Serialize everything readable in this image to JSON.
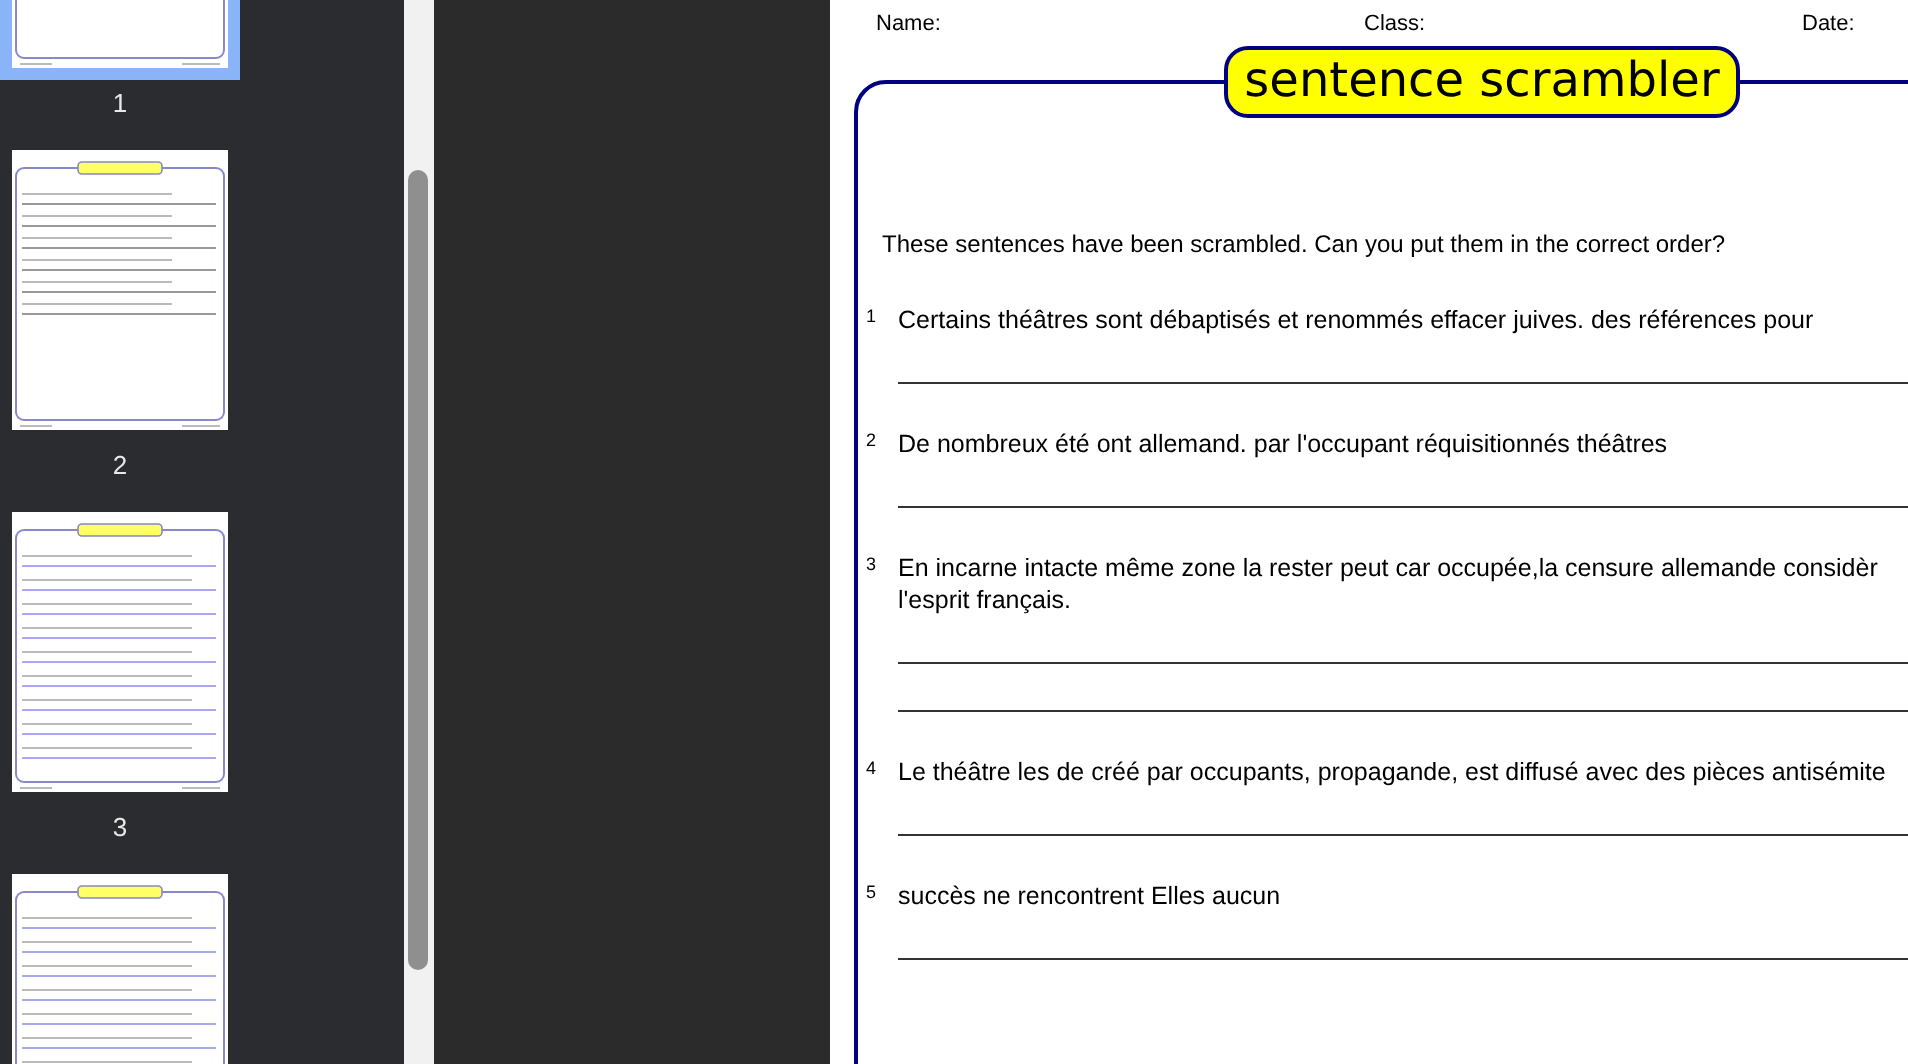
{
  "thumbnails": [
    {
      "label": "1",
      "selected": true,
      "kind": "questions"
    },
    {
      "label": "2",
      "selected": false,
      "kind": "questions"
    },
    {
      "label": "3",
      "selected": false,
      "kind": "answers"
    },
    {
      "selected": false,
      "kind": "answers"
    }
  ],
  "page": {
    "header": [
      "Name:",
      "Class:",
      "Date:"
    ],
    "title": "sentence scrambler",
    "instructions": "These sentences have been scrambled. Can you put them in the correct order?",
    "questions": [
      {
        "number": "1",
        "lines": [
          "Certains théâtres sont débaptisés et renommés effacer juives. des références pour"
        ],
        "kind": "single"
      },
      {
        "number": "2",
        "lines": [
          "De nombreux été ont allemand. par l'occupant réquisitionnés théâtres"
        ],
        "kind": "single"
      },
      {
        "number": "3",
        "lines": [
          "En incarne intacte même zone la rester peut car occupée,la censure allemande considèr",
          "l'esprit français."
        ],
        "kind": "double"
      },
      {
        "number": "4",
        "lines": [
          "Le théâtre les de créé par occupants, propagande, est diffusé avec des pièces antisémite"
        ],
        "kind": "single"
      },
      {
        "number": "5",
        "lines": [
          "succès ne rencontrent Elles aucun"
        ],
        "kind": "single"
      }
    ]
  }
}
